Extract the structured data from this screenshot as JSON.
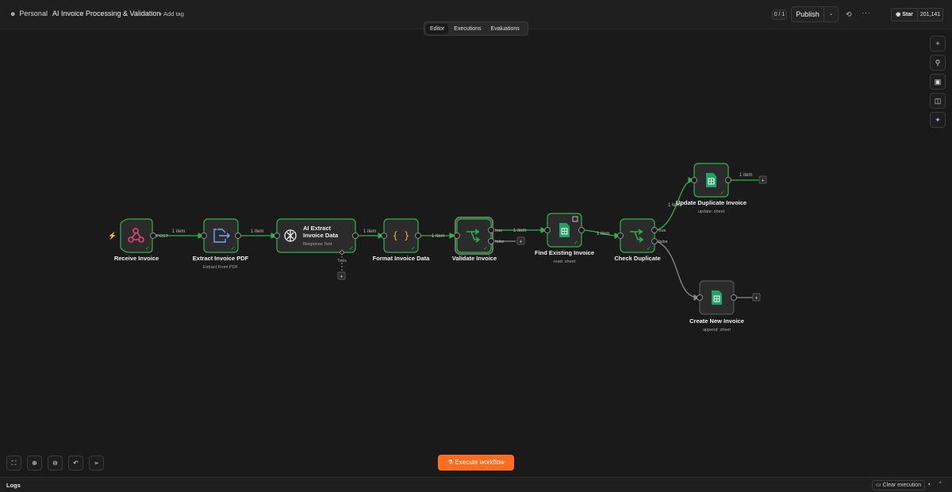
{
  "header": {
    "workspace": "Personal",
    "workspace_icon": "user-icon",
    "title": "AI Invoice Processing & Validation",
    "add_tag": "+ Add tag",
    "counter": "0 / 1",
    "publish": "Publish",
    "github_star": "Star",
    "github_count": "201,141"
  },
  "tabs": [
    {
      "label": "Editor",
      "active": true
    },
    {
      "label": "Executions",
      "active": false
    },
    {
      "label": "Evaluations",
      "active": false
    }
  ],
  "nodes": {
    "receive": {
      "name": "Receive Invoice",
      "sub": "",
      "icon": "webhook-icon",
      "port_label": "POST"
    },
    "extract_pdf": {
      "name": "Extract Invoice PDF",
      "sub": "Extract From PDF",
      "icon": "file-export-icon"
    },
    "ai_extract": {
      "name_line1": "AI Extract",
      "name_line2": "Invoice Data",
      "sub": "Response Text",
      "icon": "openai-icon",
      "tools_label": "Tools"
    },
    "format": {
      "name": "Format Invoice Data",
      "sub": "",
      "icon": "code-braces-icon"
    },
    "validate": {
      "name": "Validate Invoice",
      "sub": "",
      "icon": "if-branch-icon",
      "true_label": "true",
      "false_label": "false"
    },
    "find": {
      "name": "Find Existing Invoice",
      "sub": "read: sheet",
      "icon": "google-sheets-icon"
    },
    "check": {
      "name": "Check Duplicate",
      "sub": "",
      "icon": "if-branch-icon",
      "true_label": "true",
      "false_label": "false"
    },
    "update": {
      "name": "Update Duplicate Invoice",
      "sub": "update: sheet",
      "icon": "google-sheets-icon"
    },
    "create": {
      "name": "Create New Invoice",
      "sub": "append: sheet",
      "icon": "google-sheets-icon"
    }
  },
  "edges": {
    "item_label": "1 item"
  },
  "toolbar": {
    "execute": "Execute workflow"
  },
  "logs": {
    "label": "Logs",
    "clear": "Clear execution"
  },
  "colors": {
    "accent": "#ff6d1f",
    "success": "#2fb24c",
    "node_bg": "#2b2b2b",
    "canvas": "#1a1a1a"
  }
}
